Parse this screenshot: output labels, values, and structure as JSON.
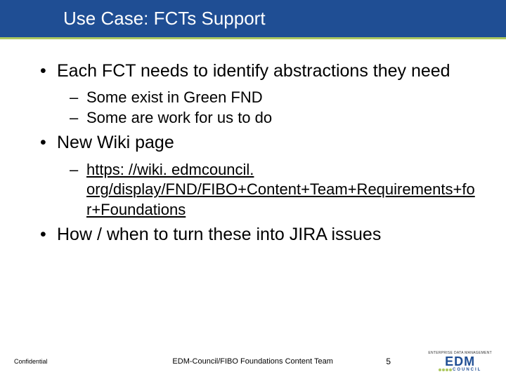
{
  "title": "Use Case: FCTs Support",
  "bullets": [
    {
      "text": "Each FCT needs to identify abstractions they need",
      "sub": [
        {
          "text": "Some exist in Green FND"
        },
        {
          "text": "Some are work for us to do"
        }
      ]
    },
    {
      "text": "New Wiki page",
      "sub": [
        {
          "link": "https: //wiki. edmcouncil. org/display/FND/FIBO+Content+Team+Requirements+for+Foundations"
        }
      ]
    },
    {
      "text": "How / when to turn these into JIRA issues",
      "sub": []
    }
  ],
  "footer": {
    "confidential": "Confidential",
    "center": "EDM-Council/FIBO Foundations Content Team",
    "page": "5",
    "logo_top": "ENTERPRISE DATA MANAGEMENT",
    "logo_main": "EDM",
    "logo_council": "COUNCIL"
  }
}
